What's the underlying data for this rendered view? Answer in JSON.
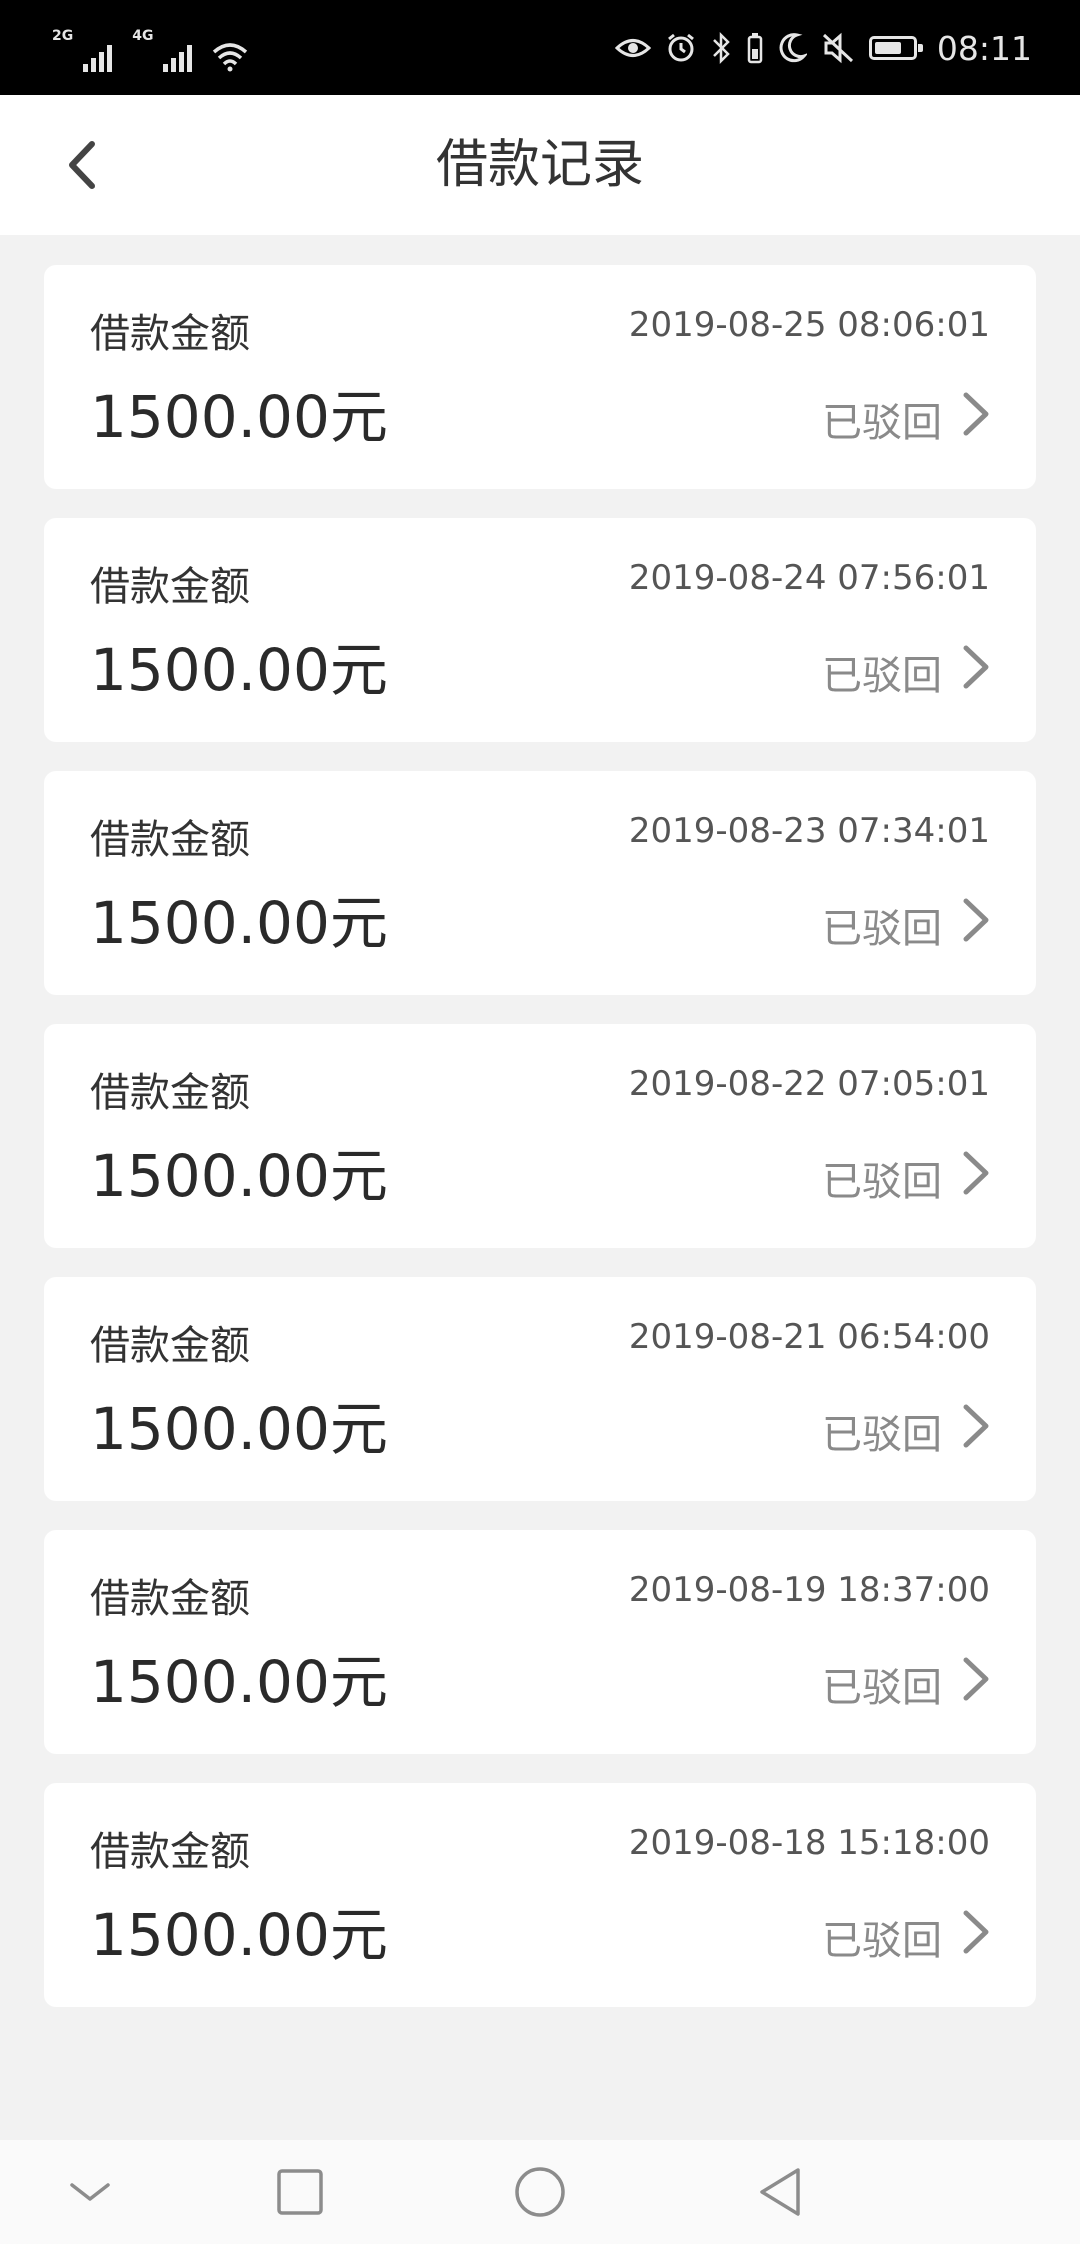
{
  "status_bar": {
    "network1": "2G",
    "network2": "4G",
    "time": "08:11",
    "icons": [
      "eye-icon",
      "alarm-icon",
      "bluetooth-icon",
      "moon-icon",
      "mute-icon",
      "battery-icon"
    ]
  },
  "header": {
    "title": "借款记录",
    "back_icon": "chevron-left-icon"
  },
  "records": [
    {
      "label": "借款金额",
      "time": "2019-08-25 08:06:01",
      "amount": "1500.00元",
      "status": "已驳回"
    },
    {
      "label": "借款金额",
      "time": "2019-08-24 07:56:01",
      "amount": "1500.00元",
      "status": "已驳回"
    },
    {
      "label": "借款金额",
      "time": "2019-08-23 07:34:01",
      "amount": "1500.00元",
      "status": "已驳回"
    },
    {
      "label": "借款金额",
      "time": "2019-08-22 07:05:01",
      "amount": "1500.00元",
      "status": "已驳回"
    },
    {
      "label": "借款金额",
      "time": "2019-08-21 06:54:00",
      "amount": "1500.00元",
      "status": "已驳回"
    },
    {
      "label": "借款金额",
      "time": "2019-08-19 18:37:00",
      "amount": "1500.00元",
      "status": "已驳回"
    },
    {
      "label": "借款金额",
      "time": "2019-08-18 15:18:00",
      "amount": "1500.00元",
      "status": "已驳回"
    }
  ],
  "nav_bar": {
    "icons": [
      "hide-keyboard-icon",
      "recents-icon",
      "home-icon",
      "back-icon"
    ]
  },
  "colors": {
    "background": "#f2f2f2",
    "card": "#ffffff",
    "status_text": "#8a8a8a",
    "title_text": "#333333"
  }
}
